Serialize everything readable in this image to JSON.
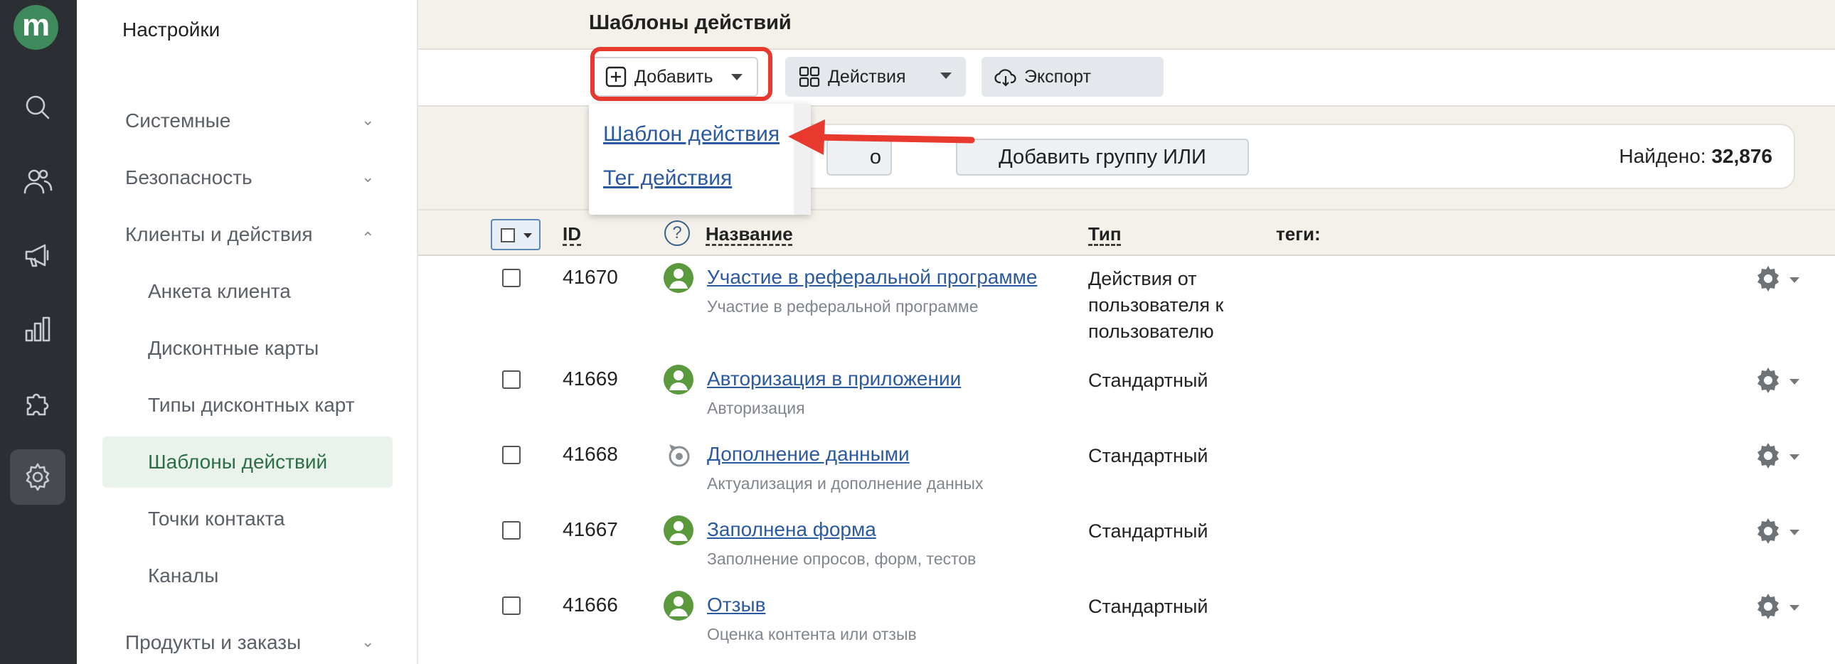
{
  "rail": {
    "logo": "m",
    "items": [
      "search-icon",
      "users-icon",
      "megaphone-icon",
      "bar-chart-icon",
      "puzzle-icon",
      "gear-icon"
    ],
    "active": "gear-icon"
  },
  "sidebar": {
    "title": "Настройки",
    "sections": [
      {
        "label": "Системные",
        "expanded": false
      },
      {
        "label": "Безопасность",
        "expanded": false
      },
      {
        "label": "Клиенты и действия",
        "expanded": true
      },
      {
        "label": "Продукты и заказы",
        "expanded": false
      }
    ],
    "subitems": [
      "Анкета клиента",
      "Дисконтные карты",
      "Типы дисконтных карт",
      "Шаблоны действий",
      "Точки контакта",
      "Каналы"
    ],
    "selected": "Шаблоны действий"
  },
  "header": {
    "title": "Шаблоны действий"
  },
  "toolbar": {
    "add_label": "Добавить",
    "actions_label": "Действия",
    "export_label": "Экспорт"
  },
  "dropdown": {
    "items": [
      "Шаблон действия",
      "Тег действия"
    ]
  },
  "filter": {
    "hidden_button_fragment": "о",
    "or_group_label": "Добавить группу ИЛИ",
    "found_label": "Найдено:",
    "found_count": "32,876"
  },
  "table": {
    "headers": {
      "id": "ID",
      "help": "?",
      "name": "Название",
      "type": "Тип",
      "tags": "теги:"
    },
    "rows": [
      {
        "id": "41670",
        "name": "Участие в реферальной программе",
        "desc": "Участие в реферальной программе",
        "type": "Действия от пользователя к пользователю",
        "icon": "user-avatar-icon"
      },
      {
        "id": "41669",
        "name": "Авторизация в приложении",
        "desc": "Авторизация",
        "type": "Стандартный",
        "icon": "user-avatar-icon"
      },
      {
        "id": "41668",
        "name": "Дополнение данными",
        "desc": "Актуализация и дополнение данных",
        "type": "Стандартный",
        "icon": "refresh-target-icon"
      },
      {
        "id": "41667",
        "name": "Заполнена форма",
        "desc": "Заполнение опросов, форм, тестов",
        "type": "Стандартный",
        "icon": "user-avatar-icon"
      },
      {
        "id": "41666",
        "name": "Отзыв",
        "desc": "Оценка контента или отзыв",
        "type": "Стандартный",
        "icon": "user-avatar-icon"
      }
    ]
  },
  "colors": {
    "accent_green": "#3e8a5c",
    "highlight_red": "#e8392e",
    "link_blue": "#2b5aa0",
    "rail_bg": "#2b2f33"
  }
}
